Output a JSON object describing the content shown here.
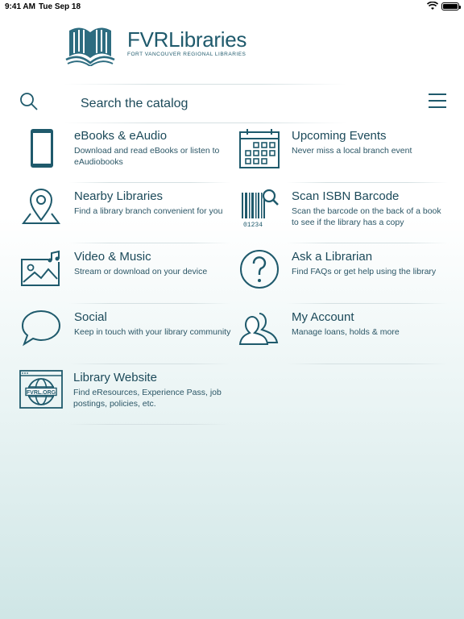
{
  "status_bar": {
    "time": "9:41 AM",
    "date": "Tue Sep 18",
    "wifi_icon": "wifi-icon",
    "battery_icon": "battery-icon"
  },
  "logo": {
    "name": "FVRLibraries",
    "subtitle": "FORT VANCOUVER REGIONAL LIBRARIES"
  },
  "search": {
    "placeholder": "Search the catalog",
    "icon": "search-icon"
  },
  "menu": {
    "icon": "hamburger-menu-icon"
  },
  "colors": {
    "primary": "#1f5a6c",
    "text": "#1c4a5a"
  },
  "tiles": [
    {
      "title": "eBooks & eAudio",
      "desc": "Download and read eBooks or listen to eAudiobooks",
      "icon": "tablet-icon"
    },
    {
      "title": "Upcoming Events",
      "desc": "Never miss a local branch event",
      "icon": "calendar-icon"
    },
    {
      "title": "Nearby Libraries",
      "desc": "Find a library branch convenient for you",
      "icon": "map-pin-icon"
    },
    {
      "title": "Scan ISBN Barcode",
      "desc": "Scan the barcode on the back of a book to see if the library has a copy",
      "icon": "barcode-icon",
      "barcode_digits": "01234"
    },
    {
      "title": "Video & Music",
      "desc": "Stream or download on your device",
      "icon": "media-icon"
    },
    {
      "title": "Ask a Librarian",
      "desc": "Find FAQs or get help using the library",
      "icon": "question-icon"
    },
    {
      "title": "Social",
      "desc": "Keep in touch with your library community",
      "icon": "speech-bubble-icon"
    },
    {
      "title": "My Account",
      "desc": "Manage loans, holds & more",
      "icon": "users-icon"
    },
    {
      "title": "Library Website",
      "desc": "Find eResources, Experience Pass, job postings, policies, etc.",
      "icon": "website-globe-icon",
      "badge": "FVRL.ORG"
    }
  ]
}
